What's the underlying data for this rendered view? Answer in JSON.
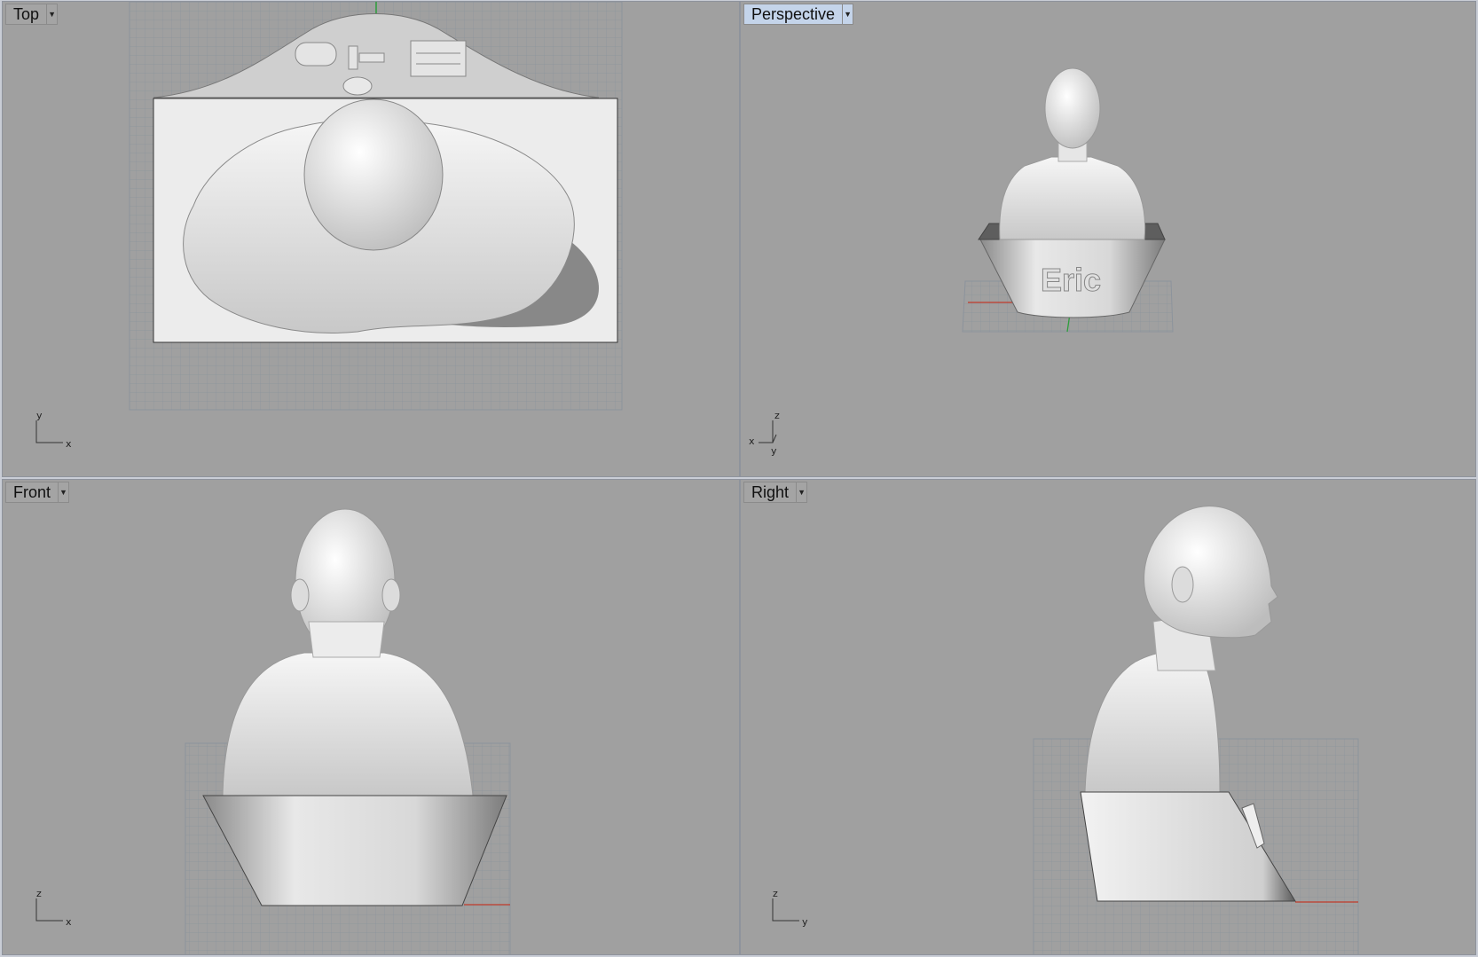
{
  "viewports": {
    "top": {
      "label": "Top",
      "axes": [
        "y",
        "x"
      ]
    },
    "persp": {
      "label": "Perspective",
      "axes": [
        "z",
        "x",
        "y"
      ],
      "base_text": "Eric"
    },
    "front": {
      "label": "Front",
      "axes": [
        "z",
        "x"
      ]
    },
    "right": {
      "label": "Right",
      "axes": [
        "z",
        "y"
      ]
    }
  },
  "icons": {
    "dropdown": "chevron-down-icon"
  },
  "colors": {
    "viewport_bg": "#a0a0a0",
    "active_label_bg": "#c4d4ea",
    "grid_line": "#8c939c",
    "x_axis": "#c0392b",
    "y_axis": "#2e9e3c",
    "model": "#eeeeee"
  }
}
